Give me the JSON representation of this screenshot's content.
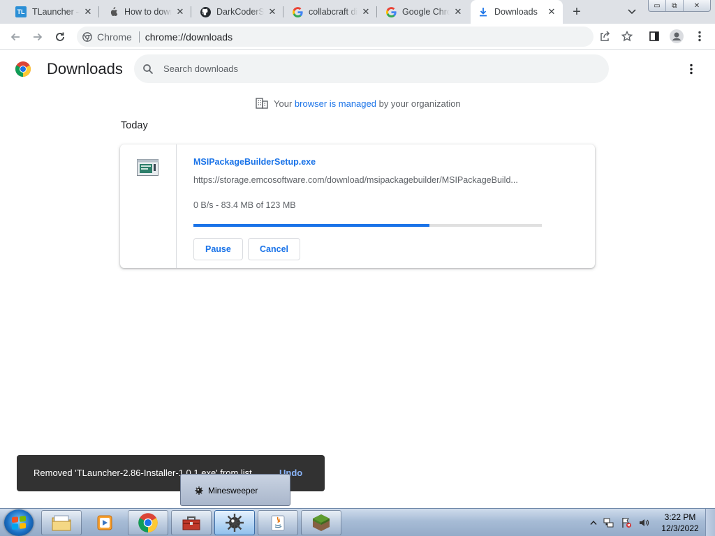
{
  "browser": {
    "tabs": [
      {
        "title": "TLauncher — ",
        "favicon": "tlauncher-icon",
        "active": false
      },
      {
        "title": "How to down",
        "favicon": "apple-icon",
        "active": false
      },
      {
        "title": "DarkCoderSc",
        "favicon": "github-icon",
        "active": false
      },
      {
        "title": "collabcraft di",
        "favicon": "google-icon",
        "active": false
      },
      {
        "title": "Google Chro",
        "favicon": "google-icon",
        "active": false
      },
      {
        "title": "Downloads",
        "favicon": "download-icon",
        "active": true
      }
    ],
    "window_controls": {
      "minimize": "▭",
      "restore": "⧉",
      "close": "✕"
    },
    "omnibox": {
      "chip_label": "Chrome",
      "url": "chrome://downloads"
    }
  },
  "downloads_page": {
    "title": "Downloads",
    "search_placeholder": "Search downloads",
    "managed_notice": {
      "prefix": "Your",
      "link": "browser is managed",
      "suffix": "by your organization"
    },
    "section_label": "Today",
    "items": [
      {
        "file_name": "MSIPackageBuilderSetup.exe",
        "url": "https://storage.emcosoftware.com/download/msipackagebuilder/MSIPackageBuild...",
        "status": "0 B/s - 83.4 MB of 123 MB",
        "progress": 0.678,
        "actions": [
          "Pause",
          "Cancel"
        ]
      }
    ]
  },
  "toast": {
    "message": "Removed 'TLauncher-2.86-Installer-1.0.1.exe' from list",
    "action": "Undo"
  },
  "taskbar": {
    "tooltip": "Minesweeper",
    "apps": [
      "explorer-icon",
      "media-player-icon",
      "chrome-icon",
      "toolbox-icon",
      "minesweeper-icon",
      "java-icon",
      "minecraft-icon"
    ],
    "clock": {
      "time": "3:22 PM",
      "date": "12/3/2022"
    }
  },
  "colors": {
    "accent": "#1a73e8",
    "tabstrip": "#dee1e6",
    "toast_bg": "#323232",
    "undo": "#8ab4f8"
  }
}
